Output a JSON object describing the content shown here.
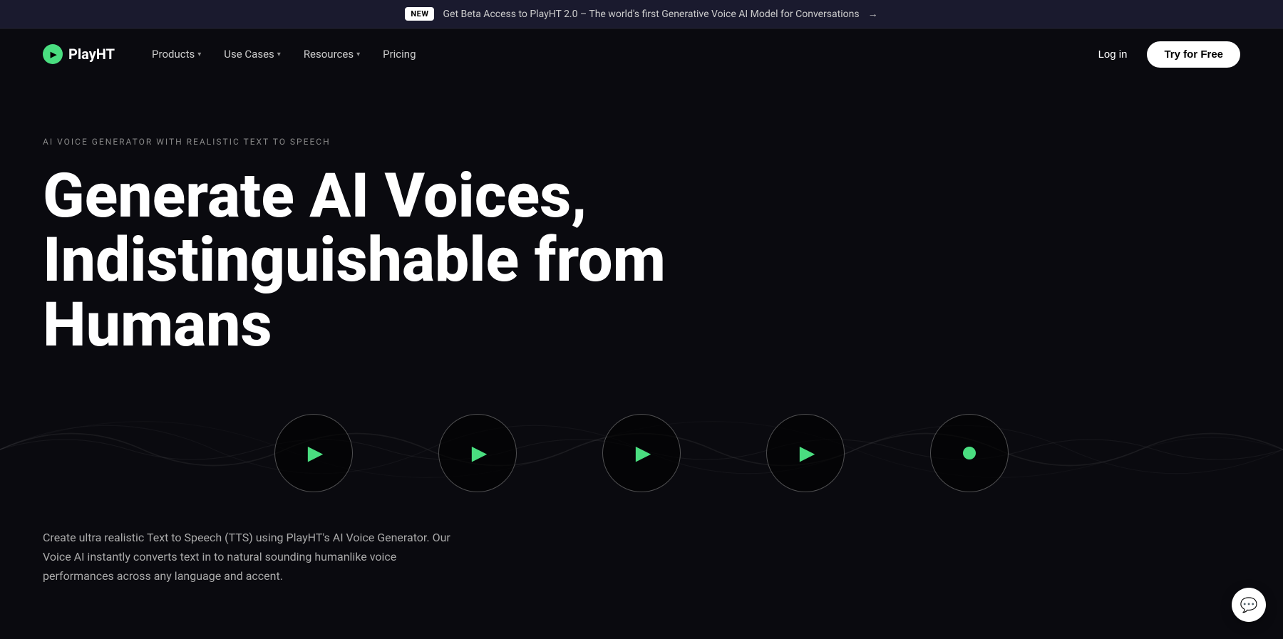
{
  "banner": {
    "badge": "NEW",
    "text": "Get Beta Access to PlayHT 2.0 – The world's first Generative Voice AI Model for Conversations",
    "arrow": "→"
  },
  "nav": {
    "logo_text": "PlayHT",
    "links": [
      {
        "label": "Products",
        "has_dropdown": true
      },
      {
        "label": "Use Cases",
        "has_dropdown": true
      },
      {
        "label": "Resources",
        "has_dropdown": true
      },
      {
        "label": "Pricing",
        "has_dropdown": false
      }
    ],
    "login": "Log in",
    "try_free": "Try for Free"
  },
  "hero": {
    "eyebrow": "AI VOICE GENERATOR WITH REALISTIC TEXT TO SPEECH",
    "title_line1": "Generate AI Voices,",
    "title_line2": "Indistinguishable from Humans"
  },
  "players": [
    {
      "type": "play",
      "id": 1
    },
    {
      "type": "play",
      "id": 2
    },
    {
      "type": "play",
      "id": 3
    },
    {
      "type": "play",
      "id": 4
    },
    {
      "type": "dot",
      "id": 5
    }
  ],
  "description": "Create ultra realistic Text to Speech (TTS) using PlayHT's AI Voice Generator. Our Voice AI instantly converts text in to natural sounding humanlike voice performances across any language and accent.",
  "chat_widget": {
    "icon": "💬"
  }
}
